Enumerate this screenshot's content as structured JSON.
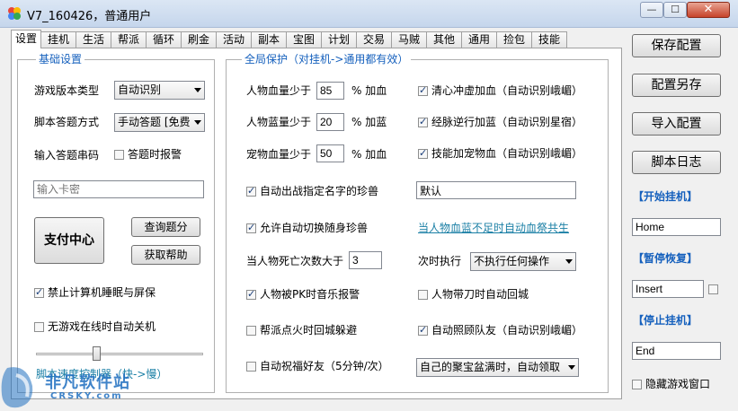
{
  "window": {
    "title": "V7_160426，普通用户",
    "min_label": "—",
    "max_label": "☐",
    "close_label": "✕"
  },
  "tabs": [
    "设置",
    "挂机",
    "生活",
    "帮派",
    "循环",
    "刷金",
    "活动",
    "副本",
    "宝图",
    "计划",
    "交易",
    "马贼",
    "其他",
    "通用",
    "捡包",
    "技能"
  ],
  "basic": {
    "title": "基础设置",
    "version_label": "游戏版本类型",
    "version_value": "自动识别",
    "answer_label": "脚本答题方式",
    "answer_value": "手动答题 [免费",
    "code_label": "输入答题串码",
    "alarm_label": "答题时报警",
    "card_placeholder": "输入卡密",
    "pay_button": "支付中心",
    "query_button": "查询题分",
    "help_button": "获取帮助",
    "sleep_label": "禁止计算机睡眠与屏保",
    "shutdown_label": "无游戏在线时自动关机",
    "speed_label": "脚本速度控制器（快->慢）"
  },
  "global": {
    "title": "全局保护（对挂机->通用都有效）",
    "hp_label": "人物血量少于",
    "hp_value": "85",
    "hp_suffix": "% 加血",
    "mp_label": "人物蓝量少于",
    "mp_value": "20",
    "mp_suffix": "% 加蓝",
    "pet_label": "宠物血量少于",
    "pet_value": "50",
    "pet_suffix": "% 加血",
    "chk_clear": "清心冲虚加血（自动识别峨嵋）",
    "chk_meridian": "经脉逆行加蓝（自动识别星宿）",
    "chk_skill_pet": "技能加宠物血（自动识别峨嵋）",
    "chk_auto_battle": "自动出战指定名字的珍兽",
    "pet_name_value": "默认",
    "chk_switch_pet": "允许自动切换随身珍兽",
    "link_share_hp": "当人物血蓝不足时自动血祭共生",
    "death_label": "当人物死亡次数大于",
    "death_value": "3",
    "next_label": "次时执行",
    "next_value": "不执行任何操作",
    "chk_pk_alarm": "人物被PK时音乐报警",
    "chk_fire_return": "人物带刀时自动回城",
    "chk_guild_fire": "帮派点火时回城躲避",
    "chk_care_team": "自动照顾队友（自动识别峨嵋）",
    "chk_bless": "自动祝福好友（5分钟/次）",
    "bowl_value": "自己的聚宝盆满时，自动领取"
  },
  "right": {
    "save_button": "保存配置",
    "save_as_button": "配置另存",
    "import_button": "导入配置",
    "log_button": "脚本日志",
    "start_label": "【开始挂机】",
    "start_key": "Home",
    "pause_label": "【暂停恢复】",
    "pause_key": "Insert",
    "stop_label": "【停止挂机】",
    "stop_key": "End",
    "hide_label": "隐藏游戏窗口"
  },
  "watermark": {
    "text": "非凡软件站",
    "sub": "CRSKY.com"
  },
  "checks": {
    "alarm": false,
    "sleep": true,
    "shutdown": false,
    "chk_clear": true,
    "chk_meridian": true,
    "chk_skill_pet": true,
    "chk_auto_battle": true,
    "chk_switch_pet": true,
    "chk_pk_alarm": true,
    "chk_fire_return": false,
    "chk_guild_fire": false,
    "chk_care_team": true,
    "chk_bless": false,
    "pause_extra": false,
    "hide": false
  },
  "colors": {
    "accent_blue": "#1560bd",
    "link_teal": "#1a7fa5",
    "card_red": "#e00000"
  }
}
